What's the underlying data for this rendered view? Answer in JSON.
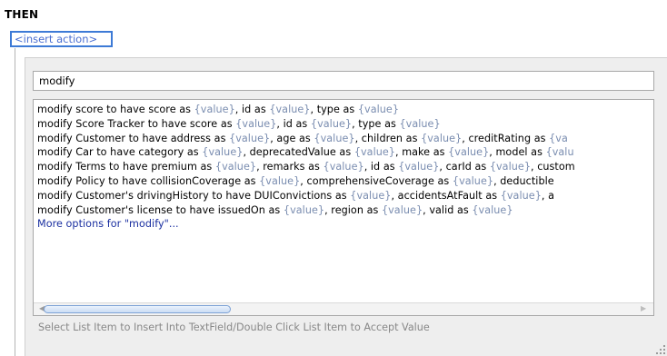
{
  "section_label": "THEN",
  "insert_action": "<insert action>",
  "search": {
    "value": "modify"
  },
  "list": {
    "items": [
      [
        {
          "t": "modify score to have score as ",
          "p": false
        },
        {
          "t": "{value}",
          "p": true
        },
        {
          "t": ", id as ",
          "p": false
        },
        {
          "t": "{value}",
          "p": true
        },
        {
          "t": ", type as ",
          "p": false
        },
        {
          "t": "{value}",
          "p": true
        }
      ],
      [
        {
          "t": "modify Score Tracker to have score as ",
          "p": false
        },
        {
          "t": "{value}",
          "p": true
        },
        {
          "t": ", id as ",
          "p": false
        },
        {
          "t": "{value}",
          "p": true
        },
        {
          "t": ", type as ",
          "p": false
        },
        {
          "t": "{value}",
          "p": true
        }
      ],
      [
        {
          "t": "modify Customer to have address as ",
          "p": false
        },
        {
          "t": "{value}",
          "p": true
        },
        {
          "t": ", age as ",
          "p": false
        },
        {
          "t": "{value}",
          "p": true
        },
        {
          "t": ", children as ",
          "p": false
        },
        {
          "t": "{value}",
          "p": true
        },
        {
          "t": ", creditRating as ",
          "p": false
        },
        {
          "t": "{va",
          "p": true
        }
      ],
      [
        {
          "t": "modify Car to have category as ",
          "p": false
        },
        {
          "t": "{value}",
          "p": true
        },
        {
          "t": ", deprecatedValue as ",
          "p": false
        },
        {
          "t": "{value}",
          "p": true
        },
        {
          "t": ", make as ",
          "p": false
        },
        {
          "t": "{value}",
          "p": true
        },
        {
          "t": ", model as ",
          "p": false
        },
        {
          "t": "{valu",
          "p": true
        }
      ],
      [
        {
          "t": "modify Terms to have premium as ",
          "p": false
        },
        {
          "t": "{value}",
          "p": true
        },
        {
          "t": ", remarks as ",
          "p": false
        },
        {
          "t": "{value}",
          "p": true
        },
        {
          "t": ", id as ",
          "p": false
        },
        {
          "t": "{value}",
          "p": true
        },
        {
          "t": ", carId as ",
          "p": false
        },
        {
          "t": "{value}",
          "p": true
        },
        {
          "t": ", custom",
          "p": false
        }
      ],
      [
        {
          "t": "modify Policy to have collisionCoverage as ",
          "p": false
        },
        {
          "t": "{value}",
          "p": true
        },
        {
          "t": ", comprehensiveCoverage as ",
          "p": false
        },
        {
          "t": "{value}",
          "p": true
        },
        {
          "t": ", deductible",
          "p": false
        }
      ],
      [
        {
          "t": "modify Customer's drivingHistory to have DUIConvictions as ",
          "p": false
        },
        {
          "t": "{value}",
          "p": true
        },
        {
          "t": ", accidentsAtFault as ",
          "p": false
        },
        {
          "t": "{value}",
          "p": true
        },
        {
          "t": ", a",
          "p": false
        }
      ],
      [
        {
          "t": "modify Customer's license to have issuedOn as ",
          "p": false
        },
        {
          "t": "{value}",
          "p": true
        },
        {
          "t": ", region as ",
          "p": false
        },
        {
          "t": "{value}",
          "p": true
        },
        {
          "t": ", valid as ",
          "p": false
        },
        {
          "t": "{value}",
          "p": true
        }
      ]
    ],
    "more_options": "More options for \"modify\"..."
  },
  "status_text": "Select List Item to Insert Into TextField/Double Click List Item to Accept Value",
  "colors": {
    "accent_border": "#3d7ad6",
    "placeholder_text": "#7a8db0",
    "link": "#1a2fa0"
  },
  "icons": {
    "scroll_left": "triangle-left-icon",
    "scroll_right": "triangle-right-icon",
    "resize": "resize-grip-icon"
  }
}
